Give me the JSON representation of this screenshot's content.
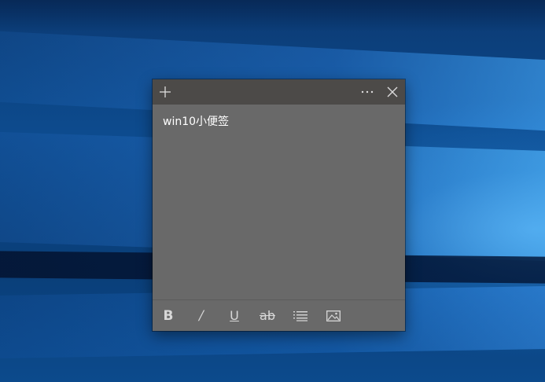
{
  "note": {
    "text": "win10小便签",
    "background_color": "#696969",
    "titlebar_color": "#4c4a48",
    "titlebar": {
      "add_icon": "plus-icon",
      "menu_icon": "more-dots-icon",
      "close_icon": "close-icon"
    },
    "toolbar": {
      "bold_label": "B",
      "italic_label": "/",
      "underline_label": "U",
      "strikethrough_label": "ab",
      "list_icon": "bulleted-list-icon",
      "image_icon": "image-icon"
    }
  }
}
